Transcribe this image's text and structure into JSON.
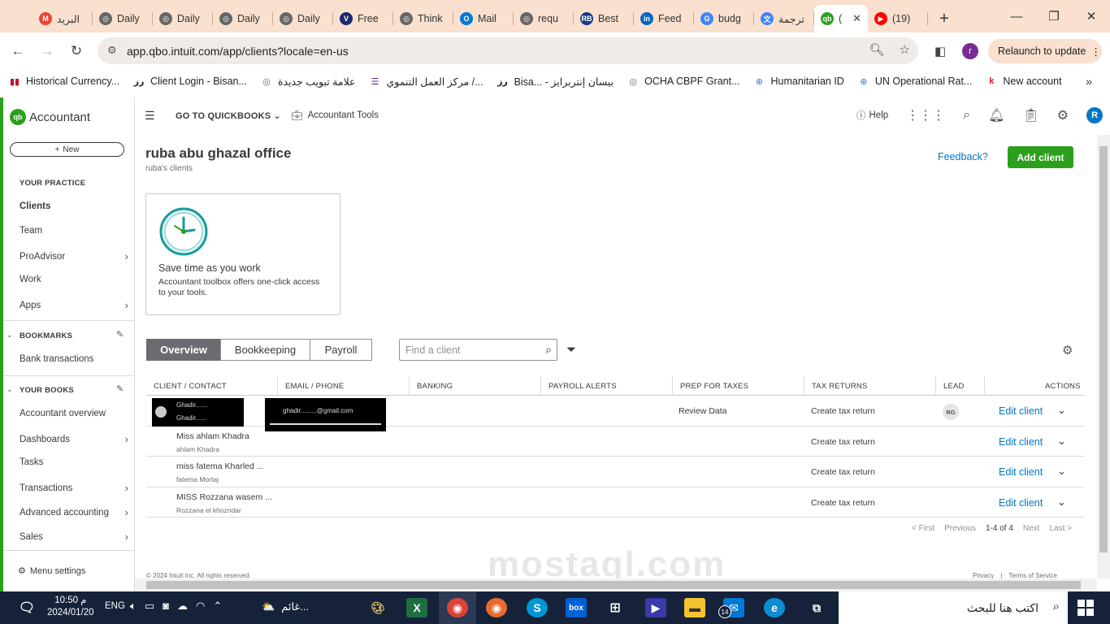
{
  "browser": {
    "tabs": [
      {
        "label": "البريد",
        "icon": "gmail-icon",
        "color": "#ea4335",
        "glyph": "M"
      },
      {
        "label": "Daily",
        "icon": "globe-icon",
        "color": "#666666",
        "glyph": "◎"
      },
      {
        "label": "Daily",
        "icon": "globe-icon",
        "color": "#666666",
        "glyph": "◎"
      },
      {
        "label": "Daily",
        "icon": "globe-icon",
        "color": "#666666",
        "glyph": "◎"
      },
      {
        "label": "Daily",
        "icon": "globe-icon",
        "color": "#666666",
        "glyph": "◎"
      },
      {
        "label": "Free",
        "icon": "vpn-icon",
        "color": "#1a2a6c",
        "glyph": "V"
      },
      {
        "label": "Think",
        "icon": "globe-icon",
        "color": "#666666",
        "glyph": "◎"
      },
      {
        "label": "Mail",
        "icon": "outlook-icon",
        "color": "#0078d4",
        "glyph": "O"
      },
      {
        "label": "requ",
        "icon": "globe-icon",
        "color": "#666666",
        "glyph": "◎"
      },
      {
        "label": "Best",
        "icon": "rb-icon",
        "color": "#1a3a8a",
        "glyph": "RB"
      },
      {
        "label": "Feed",
        "icon": "linkedin-icon",
        "color": "#0a66c2",
        "glyph": "in"
      },
      {
        "label": "budg",
        "icon": "google-icon",
        "color": "#4285f4",
        "glyph": "G"
      },
      {
        "label": "ترجمة",
        "icon": "translate-icon",
        "color": "#4285f4",
        "glyph": "文"
      }
    ],
    "active_tab": {
      "label": "(",
      "icon": "quickbooks-icon",
      "color": "#2ca01c",
      "glyph": "qb"
    },
    "last_tab": {
      "label": "(19)",
      "icon": "youtube-icon",
      "color": "#ff0000",
      "glyph": "▶"
    },
    "url": "app.qbo.intuit.com/app/clients?locale=en-us",
    "profile_initial": "r",
    "relaunch_label": "Relaunch to update",
    "bookmarks": [
      {
        "label": "Historical Currency...",
        "glyph": "▮▮",
        "color": "#c8102e"
      },
      {
        "label": "Client Login - Bisan...",
        "glyph": "ﺭﺯ",
        "color": "#222222"
      },
      {
        "label": "علامة تبويب جديدة",
        "glyph": "◎",
        "color": "#666666"
      },
      {
        "label": "مركز العمل التنموي /...",
        "glyph": "☰",
        "color": "#5b2a86"
      },
      {
        "label": "Bisa... - بيسان إنتربرايز",
        "glyph": "ﺭﺯ",
        "color": "#222222"
      },
      {
        "label": "OCHA CBPF Grant...",
        "glyph": "◎",
        "color": "#666666"
      },
      {
        "label": "Humanitarian ID",
        "glyph": "⊕",
        "color": "#5b92e5"
      },
      {
        "label": "UN Operational Rat...",
        "glyph": "⊕",
        "color": "#5b92e5"
      },
      {
        "label": "New account",
        "glyph": "k",
        "color": "#d71a21"
      }
    ]
  },
  "sidebar": {
    "brand": "Accountant",
    "new_label": "New",
    "sections": {
      "practice": "YOUR PRACTICE",
      "bookmarks": "BOOKMARKS",
      "books": "YOUR BOOKS"
    },
    "practice_items": [
      "Clients",
      "Team",
      "ProAdvisor",
      "Work",
      "Apps"
    ],
    "bookmark_items": [
      "Bank transactions"
    ],
    "book_items": [
      "Accountant overview",
      "Dashboards",
      "Tasks",
      "Transactions",
      "Advanced accounting",
      "Sales"
    ],
    "menu_settings": "Menu settings"
  },
  "topnav": {
    "goto": "GO TO QUICKBOOKS",
    "accountant_tools": "Accountant Tools",
    "help": "Help",
    "user_initial": "R"
  },
  "page": {
    "title": "ruba abu ghazal office",
    "subtitle": "ruba's clients",
    "feedback": "Feedback?",
    "add_client": "Add client"
  },
  "promo": {
    "title": "Save time as you work",
    "text": "Accountant toolbox offers one-click access to your tools."
  },
  "tabs": [
    "Overview",
    "Bookkeeping",
    "Payroll"
  ],
  "search": {
    "placeholder": "Find a client"
  },
  "table": {
    "headers": [
      "CLIENT / CONTACT",
      "EMAIL / PHONE",
      "BANKING",
      "PAYROLL ALERTS",
      "PREP FOR TAXES",
      "TAX RETURNS",
      "LEAD",
      "ACTIONS"
    ],
    "rows": [
      {
        "name": "Ghadir.......",
        "contact": "Ghadir......",
        "email": "ghadir.........@gmail.com",
        "prep": "Review Data",
        "tax": "Create tax return",
        "lead": "RG",
        "action": "Edit client"
      },
      {
        "name": "Miss ahlam Khadra",
        "contact": "ahlam Khadra",
        "email": "",
        "prep": "",
        "tax": "Create tax return",
        "lead": "",
        "action": "Edit client"
      },
      {
        "name": "miss fatema Kharled ...",
        "contact": "fatema Mortaj",
        "email": "",
        "prep": "",
        "tax": "Create tax return",
        "lead": "",
        "action": "Edit client"
      },
      {
        "name": "MISS Rozzana wasem ...",
        "contact": "Rozzana el khozndar",
        "email": "",
        "prep": "",
        "tax": "Create tax return",
        "lead": "",
        "action": "Edit client"
      }
    ]
  },
  "pager": {
    "first": "< First",
    "previous": "Previous",
    "count": "1-4 of 4",
    "next": "Next",
    "last": "Last >"
  },
  "footer": {
    "copyright": "© 2024 Intuit Inc. All rights reserved.",
    "privacy": "Privacy",
    "terms": "Terms of Service"
  },
  "watermark": "mostaql.com",
  "taskbar": {
    "time": "10:50 م",
    "date": "2024/01/20",
    "lang": "ENG",
    "weather": "غائم...",
    "search_placeholder": "اكتب هنا للبحث",
    "badge": "14"
  }
}
